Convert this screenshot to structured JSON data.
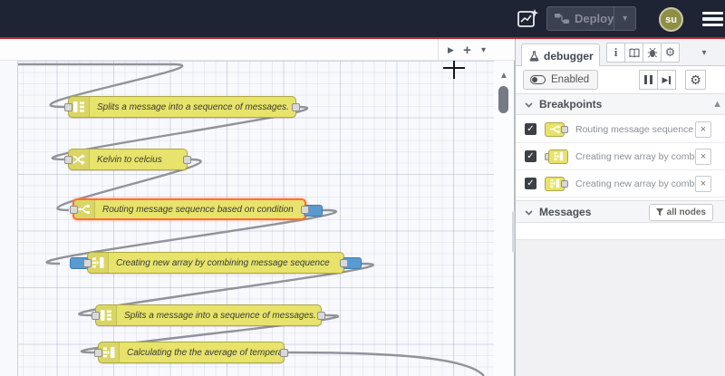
{
  "header": {
    "deploy_label": "Deploy",
    "avatar_text": "su"
  },
  "workspace_toolbar": {
    "scroll_right": "▶",
    "add_flow": "+",
    "tab_menu_caret": "▾"
  },
  "canvas": {
    "nodes": [
      {
        "type": "split",
        "label": "Splits a message into a sequence of messages."
      },
      {
        "type": "change",
        "label": "Kelvin to celcius"
      },
      {
        "type": "switch",
        "label": "Routing message sequence based on condition",
        "selected": true,
        "breakpoint_output": true
      },
      {
        "type": "join",
        "label": "Creating new array by combining message sequence",
        "breakpoint_input": true,
        "breakpoint_output": true
      },
      {
        "type": "split",
        "label": "Splits a message into a sequence of messages."
      },
      {
        "type": "join",
        "label": "Calculating the the average of temperature"
      }
    ]
  },
  "sidebar": {
    "tab_label": "debugger",
    "enabled_label": "Enabled",
    "breakpoints": {
      "title": "Breakpoints",
      "items": [
        {
          "node_type": "switch",
          "port": "output",
          "label": "Routing message sequence ba"
        },
        {
          "node_type": "join",
          "port": "input",
          "label": "Creating new array by combini"
        },
        {
          "node_type": "join",
          "port": "output",
          "label": "Creating new array by combini"
        }
      ]
    },
    "messages": {
      "title": "Messages",
      "filter_label": "all nodes"
    }
  },
  "icons": {
    "caret_down": "▾",
    "scroll_up_triangle": "▲",
    "scroll_right_triangle": "▶",
    "plus": "+",
    "gear": "⚙",
    "check": "✓",
    "close": "×",
    "info": "i"
  },
  "colors": {
    "header_bg": "#1e2433",
    "header_red_line": "#c22133",
    "node_yellow": "#e7e36b",
    "node_selected_border": "#ff7032",
    "breakpoint_blue": "#5a9ad3",
    "avatar_olive": "#8e8e45",
    "wire_gray": "#909399"
  }
}
